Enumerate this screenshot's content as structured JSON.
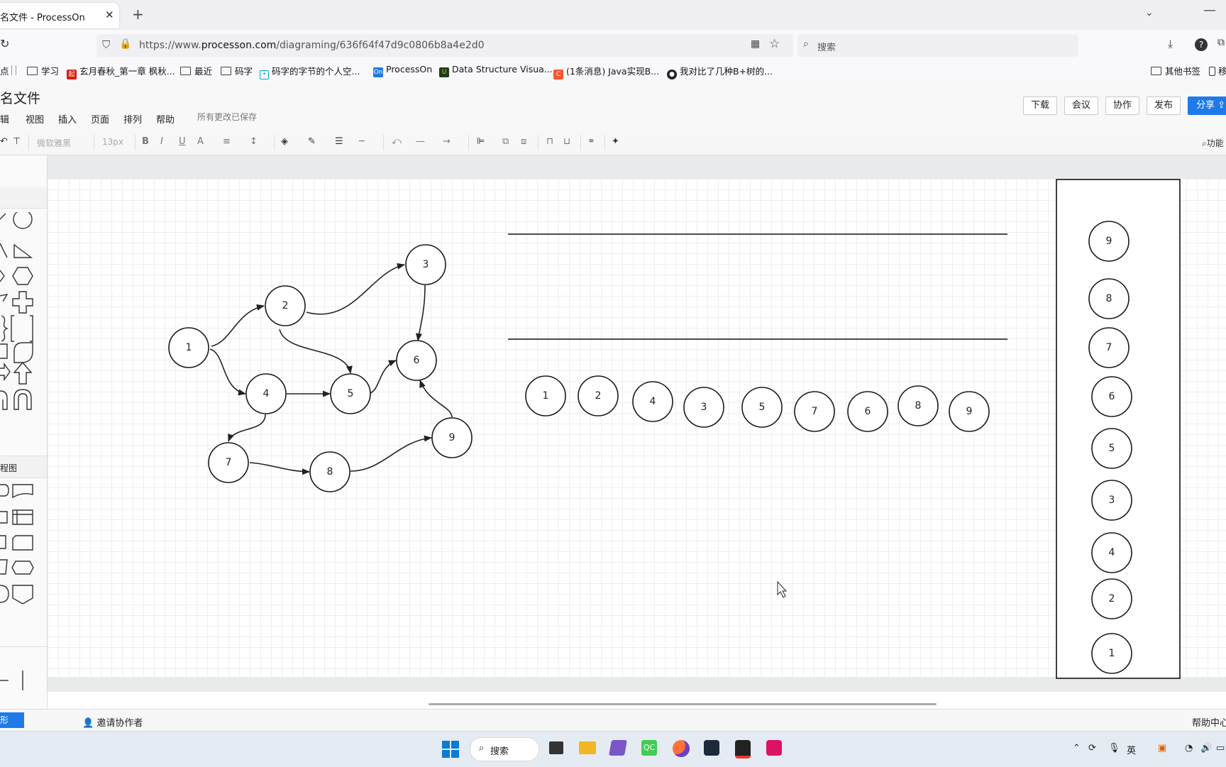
{
  "browser": {
    "tab_title": "未命名文件 - ProcessOn",
    "tab_title_visible": "名文件 - ProcessOn",
    "tab_close": "✕",
    "new_tab": "+",
    "url_prefix": "https://www.",
    "url_domain": "processon.com",
    "url_path": "/diagraming/636f64f47d9c0806b8a4e2d0",
    "search_placeholder": "搜索",
    "bookmarks": [
      {
        "label": "点",
        "icon": "none"
      },
      {
        "label": "学习",
        "icon": "folder"
      },
      {
        "label": "玄月春秋_第一章 枫秋...",
        "icon": "red-badge"
      },
      {
        "label": "最近",
        "icon": "folder"
      },
      {
        "label": "码字",
        "icon": "folder"
      },
      {
        "label": "码字的字节的个人空...",
        "icon": "bilibili-icon"
      },
      {
        "label": "ProcessOn",
        "icon": "processon-icon"
      },
      {
        "label": "Data Structure Visua...",
        "icon": "usf-icon"
      },
      {
        "label": "(1条消息) Java实现B...",
        "icon": "csdn-icon"
      },
      {
        "label": "我对比了几种B+树的...",
        "icon": "github-icon"
      },
      {
        "label": "其他书签",
        "icon": "folder"
      },
      {
        "label": "移",
        "icon": "mobile-icon"
      }
    ]
  },
  "app": {
    "doc_title": "名文件",
    "menus": [
      "辑",
      "视图",
      "插入",
      "页面",
      "排列",
      "帮助"
    ],
    "saved_status": "所有更改已保存",
    "buttons": {
      "download": "下载",
      "meeting": "会议",
      "collab": "协作",
      "publish": "发布",
      "share": "分享"
    },
    "toolbar": {
      "font": "微软雅黑",
      "size": "13px",
      "functions": "功能"
    },
    "left_panel": {
      "flowchart_section": "程图",
      "shape_button": "形"
    },
    "status": {
      "invite": "邀请协作者",
      "help_center": "帮助中心"
    }
  },
  "diagram": {
    "graph_nodes": [
      {
        "id": "1",
        "label": "1"
      },
      {
        "id": "2",
        "label": "2"
      },
      {
        "id": "3",
        "label": "3"
      },
      {
        "id": "4",
        "label": "4"
      },
      {
        "id": "5",
        "label": "5"
      },
      {
        "id": "6",
        "label": "6"
      },
      {
        "id": "7",
        "label": "7"
      },
      {
        "id": "8",
        "label": "8"
      },
      {
        "id": "9",
        "label": "9"
      }
    ],
    "graph_edges": [
      [
        "1",
        "2"
      ],
      [
        "1",
        "4"
      ],
      [
        "2",
        "3"
      ],
      [
        "2",
        "5"
      ],
      [
        "3",
        "6"
      ],
      [
        "4",
        "5"
      ],
      [
        "4",
        "7"
      ],
      [
        "5",
        "6"
      ],
      [
        "7",
        "8"
      ],
      [
        "8",
        "9"
      ],
      [
        "9",
        "6"
      ]
    ],
    "sequence_row": [
      "1",
      "2",
      "4",
      "3",
      "5",
      "7",
      "6",
      "8",
      "9"
    ],
    "stack_column_top_to_bottom": [
      "9",
      "8",
      "7",
      "6",
      "5",
      "3",
      "4",
      "2",
      "1"
    ]
  },
  "taskbar": {
    "search": "搜索",
    "ime": "英"
  }
}
